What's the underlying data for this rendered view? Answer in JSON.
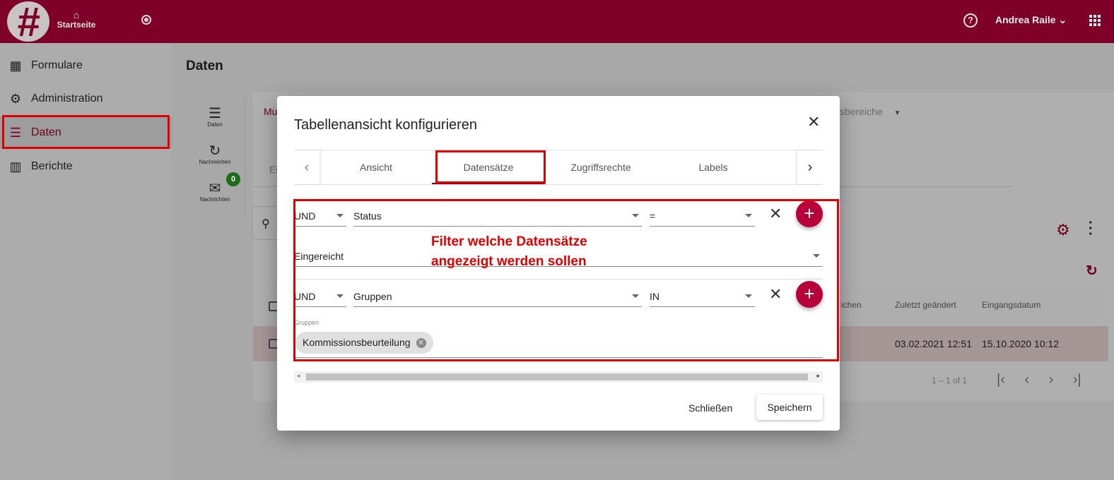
{
  "header": {
    "logo": "#",
    "home_label": "Startseite",
    "user_name": "Andrea Raile",
    "brand_color": "#7e0029"
  },
  "sidebar": {
    "items": [
      {
        "label": "Formulare",
        "icon": "dashboard-icon"
      },
      {
        "label": "Administration",
        "icon": "gear-icon"
      },
      {
        "label": "Daten",
        "icon": "storage-icon",
        "active": true
      },
      {
        "label": "Berichte",
        "icon": "bar-chart-icon"
      }
    ]
  },
  "main": {
    "title": "Daten",
    "mini_nav": [
      {
        "label": "Daten"
      },
      {
        "label": "Nachreichen"
      },
      {
        "label": "Nachrichten",
        "badge": "0"
      }
    ],
    "tab_partial": "Mu",
    "subtab_partial": "Ei",
    "dropdown_partial": "sbereiche",
    "table": {
      "headers": [
        "ichen",
        "Zuletzt geändert",
        "Eingangsdatum"
      ],
      "rows": [
        [
          "03.02.2021 12:51",
          "15.10.2020 10:12"
        ]
      ]
    },
    "pagination": "1 – 1 of 1"
  },
  "dialog": {
    "title": "Tabellenansicht konfigurieren",
    "tabs": [
      "Ansicht",
      "Datensätze",
      "Zugriffsrechte",
      "Labels"
    ],
    "active_tab": "Datensätze",
    "filters": [
      {
        "conjunction": "UND",
        "field": "Status",
        "operator": "=",
        "value": "Eingereicht"
      },
      {
        "conjunction": "UND",
        "field": "Gruppen",
        "operator": "IN",
        "value_label": "Gruppen",
        "chips": [
          "Kommissionsbeurteilung"
        ]
      }
    ],
    "annotation": [
      "Filter welche Datensätze",
      "angezeigt werden sollen"
    ],
    "close_label": "Schließen",
    "save_label": "Speichern"
  }
}
